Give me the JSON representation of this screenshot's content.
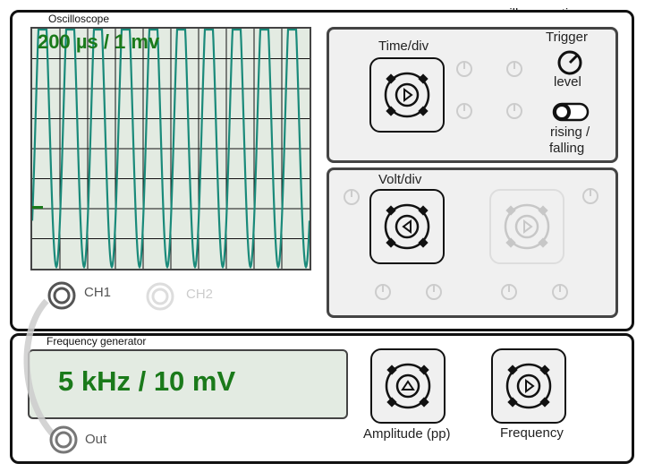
{
  "site": "oscilloscopetips.com",
  "oscilloscope": {
    "title": "Oscilloscope",
    "readout": "200 µs / 1 mv",
    "trace_color": "#1a8a7a",
    "readout_color": "#1a7a1a",
    "channels": [
      {
        "label": "CH1",
        "active": true
      },
      {
        "label": "CH2",
        "active": false
      }
    ],
    "time_div_label": "Time/div",
    "volt_div_label": "Volt/div",
    "trigger": {
      "title": "Trigger",
      "level_label": "level",
      "edge_label_1": "rising /",
      "edge_label_2": "falling"
    }
  },
  "generator": {
    "title": "Frequency generator",
    "display": "5 kHz / 10 mV",
    "out_label": "Out",
    "amplitude_label": "Amplitude (pp)",
    "frequency_label": "Frequency"
  }
}
